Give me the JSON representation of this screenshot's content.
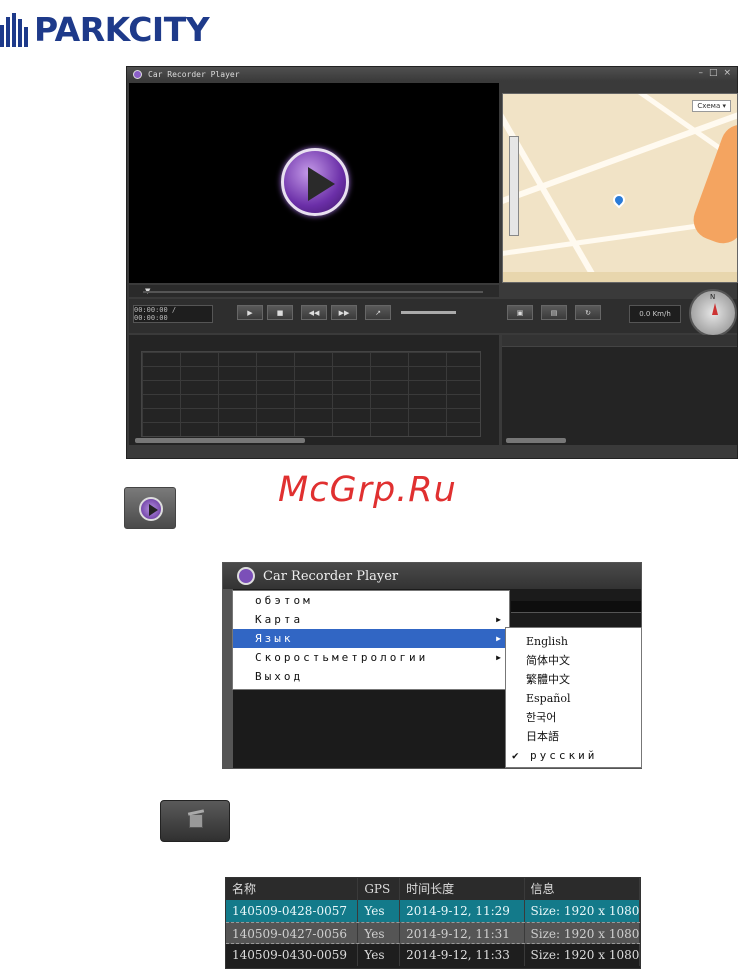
{
  "brand": {
    "name": "PARKCITY"
  },
  "player": {
    "title": "Car Recorder Player",
    "time": "00:00:00 / 00:00:00",
    "speed": "0.0 Km/h",
    "map_city_button": "Схема ▾",
    "compass_label": "N"
  },
  "watermark": "McGrp.Ru",
  "menu_window_title": "Car Recorder Player",
  "context_menu": {
    "items": [
      {
        "label": "обэтом"
      },
      {
        "label": "Карта"
      },
      {
        "label": "Язык"
      },
      {
        "label": "Скоростьметрологии"
      },
      {
        "label": "Выход"
      }
    ]
  },
  "language_menu": {
    "items": [
      {
        "label": "English"
      },
      {
        "label": "简体中文"
      },
      {
        "label": "繁體中文"
      },
      {
        "label": "Español"
      },
      {
        "label": "한국어"
      },
      {
        "label": "日本語"
      },
      {
        "label": "русский",
        "checked": true
      }
    ]
  },
  "file_table": {
    "columns": [
      "名称",
      "GPS",
      "时间长度",
      "信息"
    ],
    "rows": [
      [
        "140509-0428-0057",
        "Yes",
        "2014-9-12,  11:29",
        "Size: 1920 x 1080"
      ],
      [
        "140509-0427-0056",
        "Yes",
        "2014-9-12,  11:31",
        "Size: 1920 x 1080"
      ],
      [
        "140509-0430-0059",
        "Yes",
        "2014-9-12,  11:33",
        "Size: 1920 x 1080"
      ]
    ]
  }
}
